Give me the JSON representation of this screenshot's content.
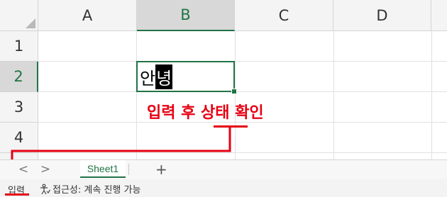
{
  "grid": {
    "columns": [
      "A",
      "B",
      "C",
      "D"
    ],
    "rows": [
      "1",
      "2",
      "3",
      "4"
    ],
    "active_column": "B",
    "active_row": "2",
    "active_cell": {
      "committed_text": "안",
      "composing_text": "녕"
    }
  },
  "annotation": {
    "text": "입력 후 상태 확인",
    "color": "#e60012"
  },
  "tabs": {
    "prev_icon": "<",
    "next_icon": ">",
    "sheet_name": "Sheet1",
    "add_icon": "+"
  },
  "status": {
    "mode": "입력",
    "accessibility": "접근성: 계속 진행 가능"
  },
  "colors": {
    "accent": "#217346",
    "annotation": "#e60012"
  }
}
